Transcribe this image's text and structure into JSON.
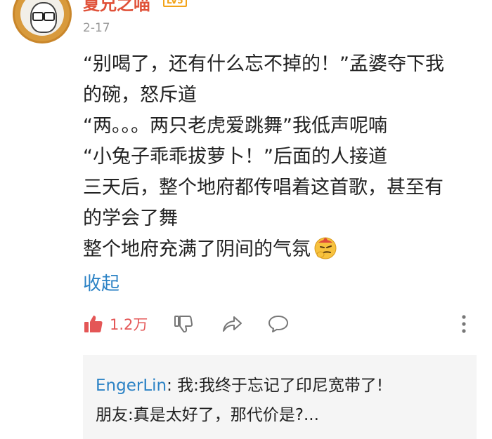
{
  "comment": {
    "username": "夏兄之喵",
    "level_badge": "LV5",
    "date": "2-17",
    "lines": [
      "“别喝了，还有什么忘不掉的！”孟婆夺下我",
      "的碗，怒斥道",
      "“两。。。两只老虎爱跳舞”我低声呢喃",
      "“小兔子乖乖拔萝卜！”后面的人接道",
      "三天后，整个地府都传唱着这首歌，甚至有",
      "的学会了舞",
      "整个地府充满了阴间的气氛"
    ],
    "collapse_label": "收起",
    "like_count": "1.2万"
  },
  "reply": {
    "author": "EngerLin",
    "text1": ": 我:我终于忘记了印尼宽带了!",
    "text2": "朋友:真是太好了，那代价是?..."
  },
  "icons": {
    "like": "thumbs-up-icon",
    "dislike": "thumbs-down-icon",
    "share": "share-arrow-icon",
    "reply": "comment-bubble-icon",
    "more": "more-vertical-icon",
    "emoji": "smirk-emoji-icon"
  },
  "colors": {
    "username": "#e0523a",
    "level_badge": "#f2a319",
    "link": "#2b82c5",
    "like": "#e45656",
    "muted": "#999999"
  }
}
